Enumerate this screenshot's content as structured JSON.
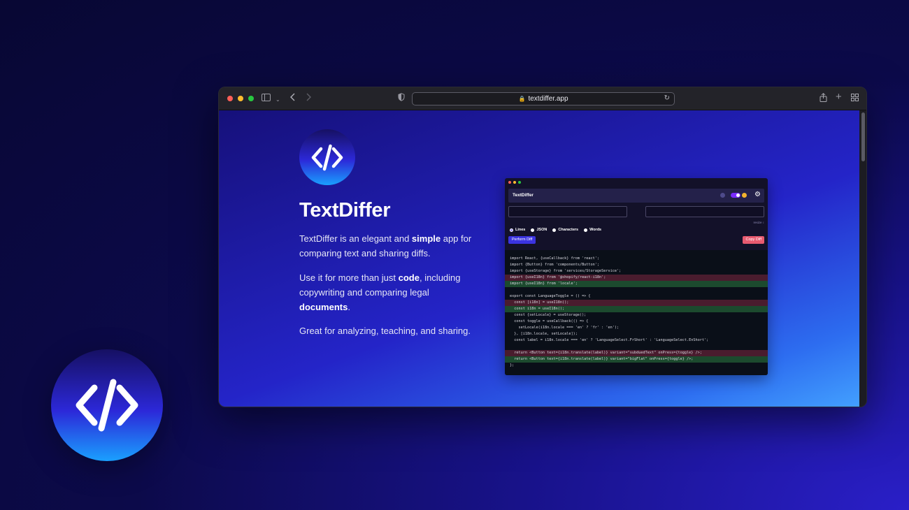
{
  "browser": {
    "url": "textdiffer.app",
    "colors": {
      "close": "#fe5f57",
      "minimize": "#febc2e",
      "zoom": "#28c840"
    }
  },
  "site": {
    "title": "TextDiffer",
    "p1": [
      {
        "text": "TextDiffer is an elegant and ",
        "bold": false
      },
      {
        "text": "simple",
        "bold": true
      },
      {
        "text": " app for comparing text and sharing diffs.",
        "bold": false
      }
    ],
    "p2": [
      {
        "text": "Use it for more than just ",
        "bold": false
      },
      {
        "text": "code",
        "bold": true
      },
      {
        "text": ", including copywriting and comparing legal ",
        "bold": false
      },
      {
        "text": "documents",
        "bold": true
      },
      {
        "text": ".",
        "bold": false
      }
    ],
    "p3": [
      {
        "text": "Great for analyzing, teaching, and sharing.",
        "bold": false
      }
    ]
  },
  "app": {
    "title": "TextDiffer",
    "resize_label": "resize ↕",
    "modes": [
      {
        "label": "Lines",
        "selected": true
      },
      {
        "label": "JSON",
        "selected": false
      },
      {
        "label": "Characters",
        "selected": false
      },
      {
        "label": "Words",
        "selected": false
      }
    ],
    "perform_label": "Perform Diff",
    "copy_label": "Copy Diff",
    "code_lines": [
      {
        "text": "import React, {useCallback} from 'react';",
        "type": "same"
      },
      {
        "text": "import {Button} from 'components/Button';",
        "type": "same"
      },
      {
        "text": "import {useStorage} from 'services/StorageService';",
        "type": "same"
      },
      {
        "text": "import {useI18n} from '@shopify/react-i18n';",
        "type": "del"
      },
      {
        "text": "import {useI18n} from 'locale';",
        "type": "add"
      },
      {
        "text": "",
        "type": "same"
      },
      {
        "text": "export const LanguageToggle = () => {",
        "type": "same"
      },
      {
        "text": "  const [i18n] = useI18n();",
        "type": "del"
      },
      {
        "text": "  const i18n = useI18n();",
        "type": "add"
      },
      {
        "text": "  const {setLocale} = useStorage();",
        "type": "same"
      },
      {
        "text": "  const toggle = useCallback(() => {",
        "type": "same"
      },
      {
        "text": "    setLocale(i18n.locale === 'en' ? 'fr' : 'en');",
        "type": "same"
      },
      {
        "text": "  }, [i18n.locale, setLocale]);",
        "type": "same"
      },
      {
        "text": "  const label = i18n.locale === 'en' ? 'LanguageSelect.FrShort' : 'LanguageSelect.EnShort';",
        "type": "same"
      },
      {
        "text": "",
        "type": "same"
      },
      {
        "text": "  return <Button text={i18n.translate(label)} variant=\"subduedText\" onPress={toggle} />;",
        "type": "del"
      },
      {
        "text": "  return <Button text={i18n.translate(label)} variant=\"bigFlat\" onPress={toggle} />;",
        "type": "add"
      },
      {
        "text": "};",
        "type": "same"
      }
    ]
  }
}
